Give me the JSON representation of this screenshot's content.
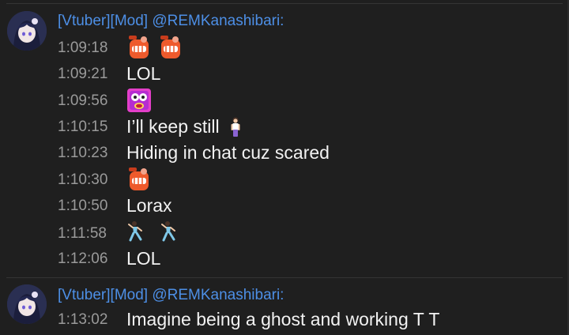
{
  "messages": [
    {
      "author": "[Vtuber][Mod] @REMKanashibari:",
      "lines": [
        {
          "time": "1:09:18",
          "text": "",
          "emotes": [
            "fist-emote",
            "fist-emote"
          ]
        },
        {
          "time": "1:09:21",
          "text": "LOL"
        },
        {
          "time": "1:09:56",
          "text": "",
          "emotes": [
            "scream-emote"
          ]
        },
        {
          "time": "1:10:15",
          "text": "I’ll keep still",
          "emotes": [
            "standing-person-icon"
          ]
        },
        {
          "time": "1:10:23",
          "text": "Hiding in chat cuz scared"
        },
        {
          "time": "1:10:30",
          "text": "",
          "emotes": [
            "fist-emote"
          ]
        },
        {
          "time": "1:10:50",
          "text": "Lorax"
        },
        {
          "time": "1:11:58",
          "text": "",
          "emotes": [
            "dancing-icon",
            "dancing-icon"
          ]
        },
        {
          "time": "1:12:06",
          "text": "LOL"
        }
      ]
    },
    {
      "author": "[Vtuber][Mod] @REMKanashibari:",
      "lines": [
        {
          "time": "1:13:02",
          "text": "Imagine being a ghost and working T T"
        }
      ]
    }
  ],
  "colors": {
    "background": "#1f1f1f",
    "author": "#4d8fe6",
    "timestamp": "#9a9a9a",
    "message": "#f2f2f2"
  }
}
